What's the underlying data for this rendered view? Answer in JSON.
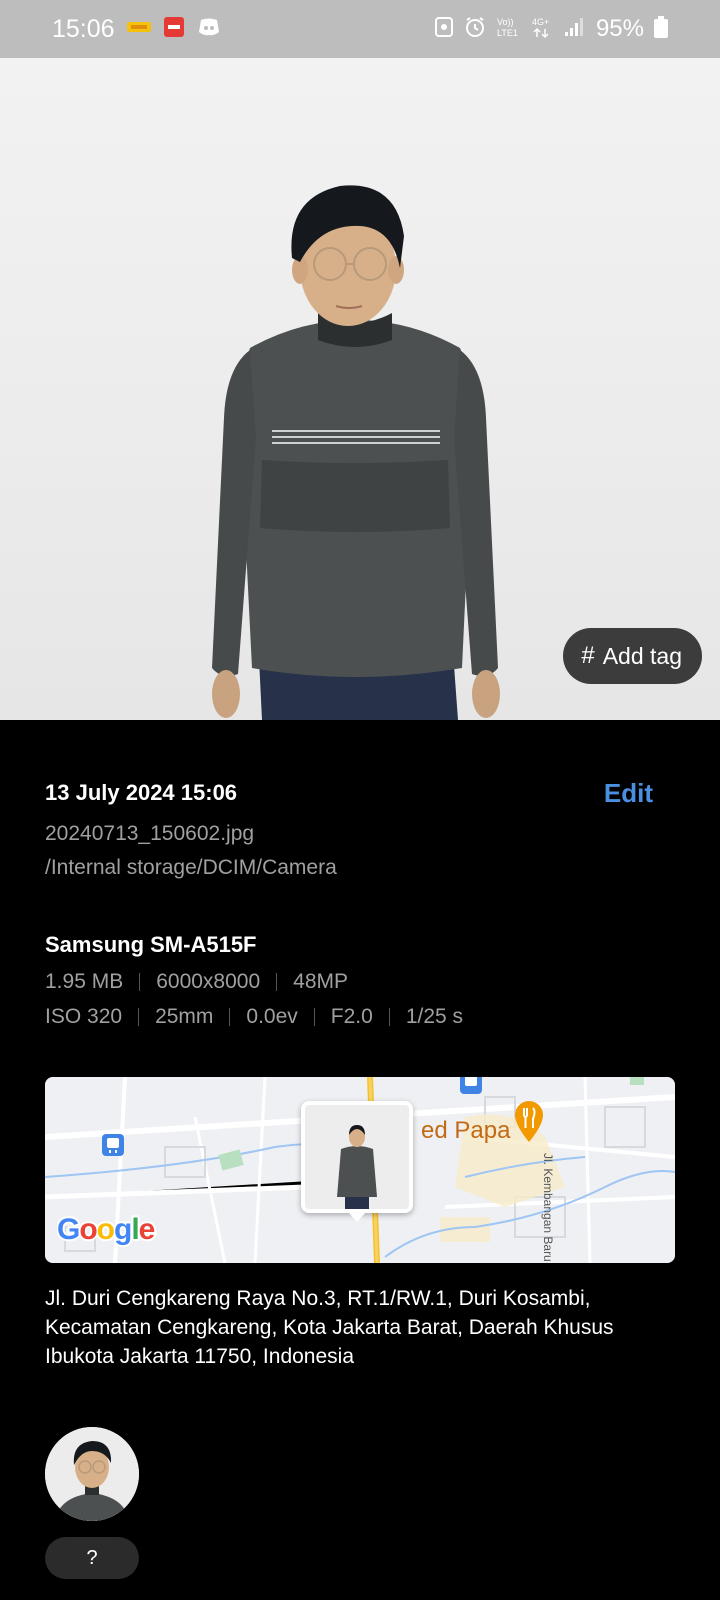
{
  "status_bar": {
    "time": "15:06",
    "battery_text": "95%",
    "network_label": "4G+",
    "volte_label": "VoLTE1"
  },
  "photo": {
    "add_tag_icon": "#",
    "add_tag_label": "Add tag"
  },
  "details": {
    "date_time": "13 July 2024 15:06",
    "edit_label": "Edit",
    "filename": "20240713_150602.jpg",
    "path": "/Internal storage/DCIM/Camera",
    "device": "Samsung SM-A515F",
    "file_size": "1.95 MB",
    "resolution": "6000x8000",
    "megapixels": "48MP",
    "iso": "ISO 320",
    "focal_length": "25mm",
    "exposure_bias": "0.0ev",
    "aperture": "F2.0",
    "shutter": "1/25 s"
  },
  "map": {
    "logo_text": "Google",
    "poi_label": "ed Papa",
    "road_label": "Jl. Kembangan Baru",
    "accent_poi": "#f29900"
  },
  "location": {
    "address": "Jl. Duri Cengkareng Raya No.3, RT.1/RW.1, Duri Kosambi, Kecamatan Cengkareng, Kota Jakarta Barat, Daerah Khusus Ibukota Jakarta 11750, Indonesia"
  },
  "people": {
    "unknown_label": "?"
  },
  "colors": {
    "accent": "#4a90e2",
    "background": "#000000"
  }
}
